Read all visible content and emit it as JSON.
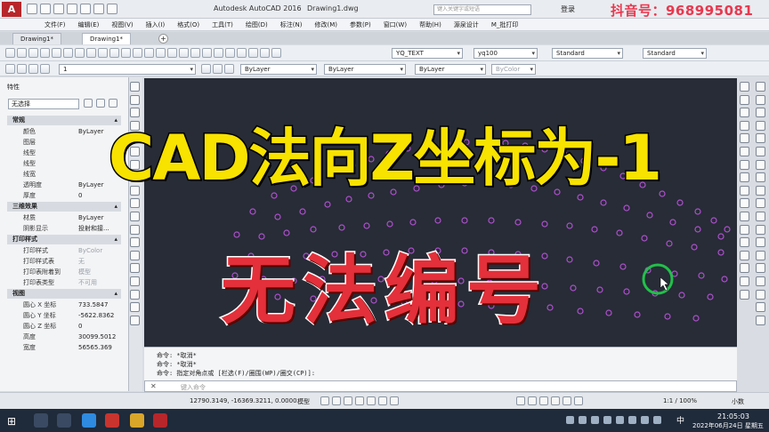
{
  "window": {
    "app_logo": "A",
    "app_title": "Autodesk AutoCAD 2016",
    "file_title": "Drawing1.dwg",
    "search_placeholder": "键入关键字或短语",
    "login": "登录",
    "watermark": "抖音号：968995081"
  },
  "menu": [
    "文件(F)",
    "编辑(E)",
    "视图(V)",
    "插入(I)",
    "格式(O)",
    "工具(T)",
    "绘图(D)",
    "标注(N)",
    "修改(M)",
    "参数(P)",
    "窗口(W)",
    "帮助(H)",
    "源泉设计",
    "M_批打印"
  ],
  "tabs": [
    {
      "label": "Drawing1*"
    },
    {
      "label": "Drawing1*"
    }
  ],
  "toolbar": {
    "text_style": "YQ_TEXT",
    "dim_style": "yq100",
    "table_style": "Standard",
    "multileader_style": "Standard",
    "layer": "1",
    "color": "ByLayer",
    "linetype": "ByLayer",
    "lineweight": "ByLayer",
    "plotstyle": "ByColor"
  },
  "properties": {
    "title": "特性",
    "selection": "无选择",
    "sections": {
      "general": "常规",
      "three_d": "三维效果",
      "plot": "打印样式",
      "view": "视图"
    },
    "general_rows": [
      {
        "k": "颜色",
        "v": "ByLayer"
      },
      {
        "k": "图层",
        "v": ""
      },
      {
        "k": "线型",
        "v": ""
      },
      {
        "k": "线型",
        "v": ""
      },
      {
        "k": "线宽",
        "v": ""
      },
      {
        "k": "透明度",
        "v": "ByLayer"
      },
      {
        "k": "厚度",
        "v": "0"
      }
    ],
    "three_d_rows": [
      {
        "k": "材质",
        "v": "ByLayer"
      },
      {
        "k": "阴影显示",
        "v": "投射和接..."
      }
    ],
    "plot_rows": [
      {
        "k": "打印样式",
        "v": "ByColor"
      },
      {
        "k": "打印样式表",
        "v": "无"
      },
      {
        "k": "打印表附着到",
        "v": "模型"
      },
      {
        "k": "打印表类型",
        "v": "不可用"
      }
    ],
    "view_rows": [
      {
        "k": "圆心 X 坐标",
        "v": "733.5847"
      },
      {
        "k": "圆心 Y 坐标",
        "v": "-5622.8362"
      },
      {
        "k": "圆心 Z 坐标",
        "v": "0"
      },
      {
        "k": "高度",
        "v": "30099.5012"
      },
      {
        "k": "宽度",
        "v": "56565.369"
      }
    ]
  },
  "command": {
    "line1": "命令: *取消*",
    "line2": "命令: *取消*",
    "line3": "命令: 指定对角点或 [栏选(F)/圈围(WP)/圈交(CP)]:",
    "placeholder": "键入命令"
  },
  "status": {
    "coords": "12790.3149, -16369.3211, 0.0000",
    "model": "模型",
    "scale": "1:1 / 100%",
    "units": "小数"
  },
  "taskbar": {
    "ime": "中",
    "time": "21:05:03",
    "date": "2022年06月24日 星期五"
  },
  "overlay": {
    "title": "CAD法向Z坐标为-1",
    "subtitle": "无法编号"
  },
  "colors": {
    "canvas": "#272c36",
    "marker": "#b04fd0",
    "cursor_ring": "#22c04a",
    "title_fill": "#f7e200",
    "subtitle_fill": "#e3303a"
  }
}
